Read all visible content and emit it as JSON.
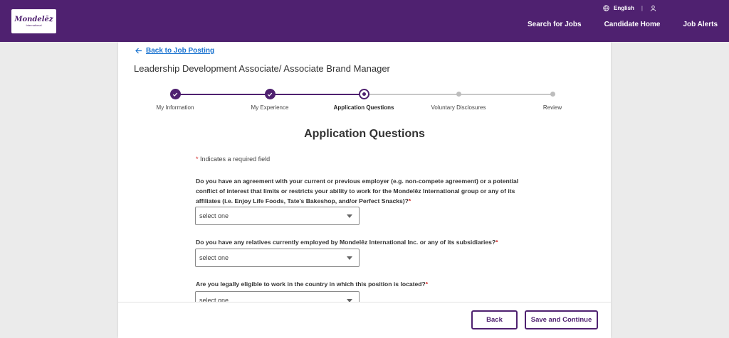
{
  "header": {
    "logo_main": "Mondelēz",
    "logo_sub": "International",
    "language": "English",
    "nav": [
      "Search for Jobs",
      "Candidate Home",
      "Job Alerts"
    ]
  },
  "colors": {
    "brand": "#4f2170",
    "link": "#1a73d0",
    "required": "#d32f2f"
  },
  "page": {
    "back_link": "Back to Job Posting",
    "job_title": "Leadership Development Associate/ Associate Brand Manager",
    "section_title": "Application Questions",
    "required_note": "Indicates a required field"
  },
  "stepper": {
    "current_index": 2,
    "steps": [
      {
        "label": "My Information",
        "state": "complete"
      },
      {
        "label": "My Experience",
        "state": "complete"
      },
      {
        "label": "Application Questions",
        "state": "current"
      },
      {
        "label": "Voluntary Disclosures",
        "state": "upcoming"
      },
      {
        "label": "Review",
        "state": "upcoming"
      }
    ]
  },
  "questions": [
    {
      "text": "Do you have an agreement with your current or previous employer (e.g. non-compete agreement) or a potential conflict of interest that limits or restricts your ability to work for the Mondelēz International group or any of its affiliates (i.e. Enjoy Life Foods, Tate's Bakeshop, and/or Perfect Snacks)?",
      "value": "select one"
    },
    {
      "text": "Do you have any relatives currently employed by Mondelēz International Inc. or any of its subsidiaries?",
      "value": "select one"
    },
    {
      "text": "Are you legally eligible to work in the country in which this position is located?",
      "value": "select one"
    }
  ],
  "footer": {
    "back_label": "Back",
    "save_label": "Save and Continue"
  }
}
